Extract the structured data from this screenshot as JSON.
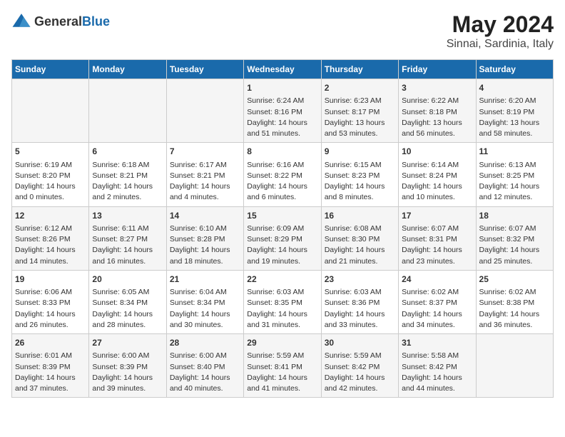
{
  "logo": {
    "general": "General",
    "blue": "Blue"
  },
  "title": "May 2024",
  "subtitle": "Sinnai, Sardinia, Italy",
  "days_of_week": [
    "Sunday",
    "Monday",
    "Tuesday",
    "Wednesday",
    "Thursday",
    "Friday",
    "Saturday"
  ],
  "weeks": [
    [
      {
        "day": "",
        "info": ""
      },
      {
        "day": "",
        "info": ""
      },
      {
        "day": "",
        "info": ""
      },
      {
        "day": "1",
        "info": "Sunrise: 6:24 AM\nSunset: 8:16 PM\nDaylight: 14 hours\nand 51 minutes."
      },
      {
        "day": "2",
        "info": "Sunrise: 6:23 AM\nSunset: 8:17 PM\nDaylight: 13 hours\nand 53 minutes."
      },
      {
        "day": "3",
        "info": "Sunrise: 6:22 AM\nSunset: 8:18 PM\nDaylight: 13 hours\nand 56 minutes."
      },
      {
        "day": "4",
        "info": "Sunrise: 6:20 AM\nSunset: 8:19 PM\nDaylight: 13 hours\nand 58 minutes."
      }
    ],
    [
      {
        "day": "5",
        "info": "Sunrise: 6:19 AM\nSunset: 8:20 PM\nDaylight: 14 hours\nand 0 minutes."
      },
      {
        "day": "6",
        "info": "Sunrise: 6:18 AM\nSunset: 8:21 PM\nDaylight: 14 hours\nand 2 minutes."
      },
      {
        "day": "7",
        "info": "Sunrise: 6:17 AM\nSunset: 8:21 PM\nDaylight: 14 hours\nand 4 minutes."
      },
      {
        "day": "8",
        "info": "Sunrise: 6:16 AM\nSunset: 8:22 PM\nDaylight: 14 hours\nand 6 minutes."
      },
      {
        "day": "9",
        "info": "Sunrise: 6:15 AM\nSunset: 8:23 PM\nDaylight: 14 hours\nand 8 minutes."
      },
      {
        "day": "10",
        "info": "Sunrise: 6:14 AM\nSunset: 8:24 PM\nDaylight: 14 hours\nand 10 minutes."
      },
      {
        "day": "11",
        "info": "Sunrise: 6:13 AM\nSunset: 8:25 PM\nDaylight: 14 hours\nand 12 minutes."
      }
    ],
    [
      {
        "day": "12",
        "info": "Sunrise: 6:12 AM\nSunset: 8:26 PM\nDaylight: 14 hours\nand 14 minutes."
      },
      {
        "day": "13",
        "info": "Sunrise: 6:11 AM\nSunset: 8:27 PM\nDaylight: 14 hours\nand 16 minutes."
      },
      {
        "day": "14",
        "info": "Sunrise: 6:10 AM\nSunset: 8:28 PM\nDaylight: 14 hours\nand 18 minutes."
      },
      {
        "day": "15",
        "info": "Sunrise: 6:09 AM\nSunset: 8:29 PM\nDaylight: 14 hours\nand 19 minutes."
      },
      {
        "day": "16",
        "info": "Sunrise: 6:08 AM\nSunset: 8:30 PM\nDaylight: 14 hours\nand 21 minutes."
      },
      {
        "day": "17",
        "info": "Sunrise: 6:07 AM\nSunset: 8:31 PM\nDaylight: 14 hours\nand 23 minutes."
      },
      {
        "day": "18",
        "info": "Sunrise: 6:07 AM\nSunset: 8:32 PM\nDaylight: 14 hours\nand 25 minutes."
      }
    ],
    [
      {
        "day": "19",
        "info": "Sunrise: 6:06 AM\nSunset: 8:33 PM\nDaylight: 14 hours\nand 26 minutes."
      },
      {
        "day": "20",
        "info": "Sunrise: 6:05 AM\nSunset: 8:34 PM\nDaylight: 14 hours\nand 28 minutes."
      },
      {
        "day": "21",
        "info": "Sunrise: 6:04 AM\nSunset: 8:34 PM\nDaylight: 14 hours\nand 30 minutes."
      },
      {
        "day": "22",
        "info": "Sunrise: 6:03 AM\nSunset: 8:35 PM\nDaylight: 14 hours\nand 31 minutes."
      },
      {
        "day": "23",
        "info": "Sunrise: 6:03 AM\nSunset: 8:36 PM\nDaylight: 14 hours\nand 33 minutes."
      },
      {
        "day": "24",
        "info": "Sunrise: 6:02 AM\nSunset: 8:37 PM\nDaylight: 14 hours\nand 34 minutes."
      },
      {
        "day": "25",
        "info": "Sunrise: 6:02 AM\nSunset: 8:38 PM\nDaylight: 14 hours\nand 36 minutes."
      }
    ],
    [
      {
        "day": "26",
        "info": "Sunrise: 6:01 AM\nSunset: 8:39 PM\nDaylight: 14 hours\nand 37 minutes."
      },
      {
        "day": "27",
        "info": "Sunrise: 6:00 AM\nSunset: 8:39 PM\nDaylight: 14 hours\nand 39 minutes."
      },
      {
        "day": "28",
        "info": "Sunrise: 6:00 AM\nSunset: 8:40 PM\nDaylight: 14 hours\nand 40 minutes."
      },
      {
        "day": "29",
        "info": "Sunrise: 5:59 AM\nSunset: 8:41 PM\nDaylight: 14 hours\nand 41 minutes."
      },
      {
        "day": "30",
        "info": "Sunrise: 5:59 AM\nSunset: 8:42 PM\nDaylight: 14 hours\nand 42 minutes."
      },
      {
        "day": "31",
        "info": "Sunrise: 5:58 AM\nSunset: 8:42 PM\nDaylight: 14 hours\nand 44 minutes."
      },
      {
        "day": "",
        "info": ""
      }
    ]
  ]
}
